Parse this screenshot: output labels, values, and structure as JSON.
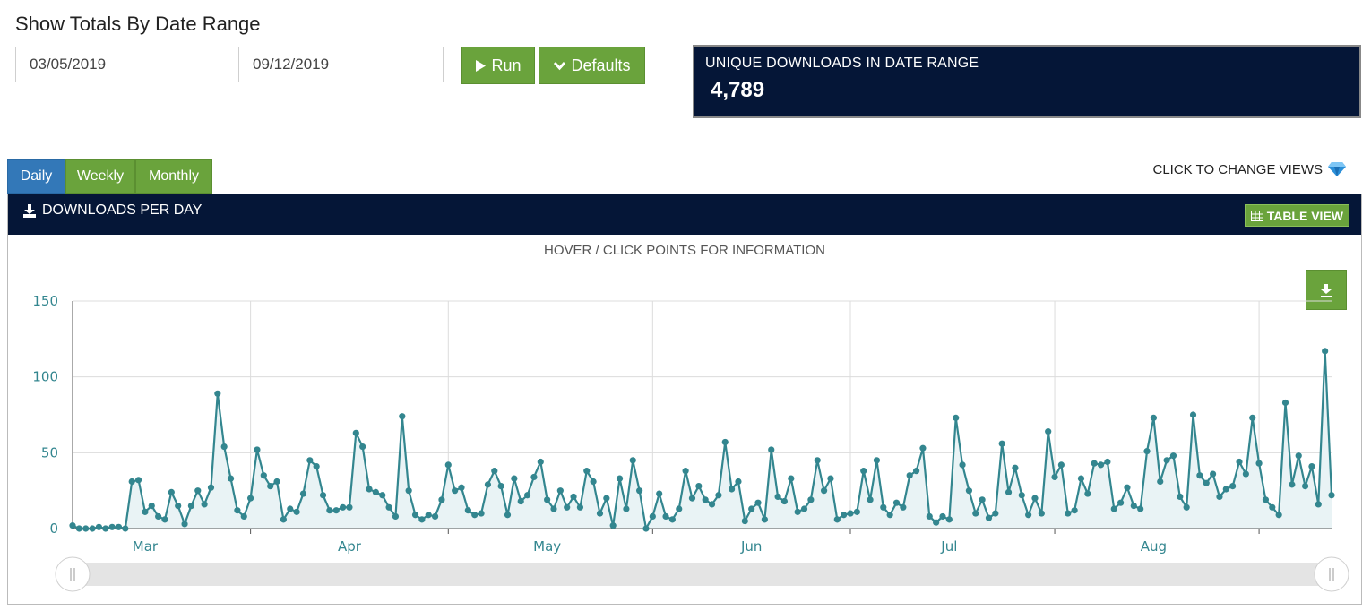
{
  "page": {
    "title": "Show Totals By Date Range"
  },
  "filters": {
    "start_date": "03/05/2019",
    "end_date": "09/12/2019",
    "run_label": "Run",
    "defaults_label": "Defaults"
  },
  "stat": {
    "label": "UNIQUE DOWNLOADS IN DATE RANGE",
    "value": "4,789"
  },
  "tabs": [
    {
      "label": "Daily",
      "active": true
    },
    {
      "label": "Weekly",
      "active": false
    },
    {
      "label": "Monthly",
      "active": false
    }
  ],
  "change_views_label": "CLICK TO CHANGE VIEWS",
  "panel": {
    "title": "DOWNLOADS PER DAY",
    "table_view_label": "TABLE VIEW",
    "hover_hint": "HOVER / CLICK POINTS FOR INFORMATION"
  },
  "colors": {
    "navy": "#051637",
    "green": "#6aa33c",
    "blue": "#3378b8",
    "series": "#33868f"
  },
  "icons": {
    "run": "play-icon",
    "defaults": "chevron-down-icon",
    "title": "download-icon",
    "table": "table-icon",
    "export": "download-icon",
    "change_views": "diamond-icon"
  },
  "chart_data": {
    "type": "area",
    "x_start": "2019-03-05",
    "x_end": "2019-09-12",
    "month_labels": [
      "Mar",
      "Apr",
      "May",
      "Jun",
      "Jul",
      "Aug"
    ],
    "month_label_dates": [
      "2019-03-16",
      "2019-04-16",
      "2019-05-16",
      "2019-06-16",
      "2019-07-16",
      "2019-08-16"
    ],
    "month_start_dates": [
      "2019-04-01",
      "2019-05-01",
      "2019-06-01",
      "2019-07-01",
      "2019-08-01",
      "2019-09-01"
    ],
    "y_ticks": [
      0,
      50,
      100,
      150
    ],
    "ylim": [
      0,
      150
    ],
    "grid": true,
    "series": [
      {
        "values": [
          2,
          0,
          0,
          0,
          1,
          0,
          1,
          1,
          0,
          31,
          32,
          11,
          15,
          8,
          6,
          24,
          15,
          3,
          15,
          25,
          16,
          27,
          89,
          54,
          33,
          12,
          8,
          20,
          52,
          35,
          28,
          31,
          6,
          13,
          11,
          23,
          45,
          41,
          22,
          12,
          12,
          14,
          14,
          63,
          54,
          26,
          24,
          22,
          14,
          8,
          74,
          25,
          9,
          6,
          9,
          8,
          19,
          42,
          25,
          27,
          12,
          9,
          10,
          29,
          38,
          28,
          9,
          33,
          18,
          22,
          34,
          44,
          19,
          13,
          25,
          14,
          21,
          14,
          38,
          31,
          10,
          20,
          2,
          33,
          13,
          45,
          25,
          0,
          8,
          23,
          8,
          6,
          13,
          38,
          20,
          28,
          19,
          16,
          22,
          57,
          26,
          31,
          5,
          13,
          17,
          6,
          52,
          21,
          18,
          33,
          11,
          13,
          19,
          45,
          25,
          33,
          6,
          9,
          10,
          11,
          38,
          19,
          45,
          14,
          9,
          17,
          14,
          35,
          38,
          53,
          8,
          4,
          8,
          6,
          73,
          42,
          25,
          10,
          19,
          7,
          10,
          56,
          24,
          40,
          22,
          9,
          20,
          10,
          64,
          34,
          42,
          10,
          12,
          33,
          23,
          43,
          42,
          44,
          13,
          17,
          27,
          15,
          13,
          51,
          73,
          31,
          45,
          48,
          21,
          14,
          75,
          35,
          30,
          36,
          21,
          26,
          28,
          44,
          36,
          73,
          43,
          19,
          14,
          9,
          83,
          29,
          48,
          28,
          41,
          16,
          117,
          22
        ]
      }
    ]
  }
}
